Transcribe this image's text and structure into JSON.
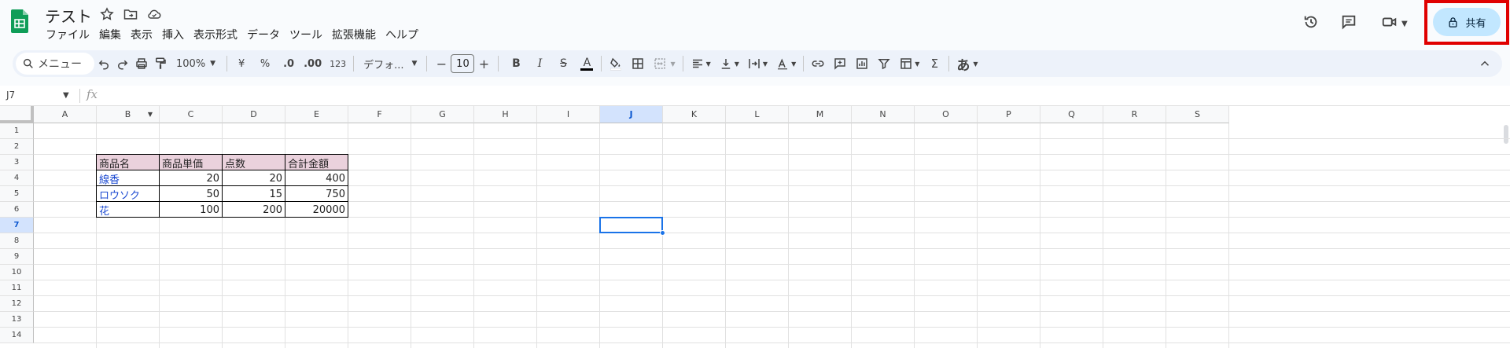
{
  "doc": {
    "title": "テスト"
  },
  "menu": [
    "ファイル",
    "編集",
    "表示",
    "挿入",
    "表示形式",
    "データ",
    "ツール",
    "拡張機能",
    "ヘルプ"
  ],
  "share": {
    "label": "共有"
  },
  "toolbar": {
    "search_label": "メニュー",
    "zoom": "100%",
    "currency": "¥",
    "percent": "%",
    "dec_decrease": ".0",
    "dec_increase": ".00",
    "number_format": "123",
    "font": "デフォ...",
    "font_size": "10",
    "minus": "−",
    "plus": "+",
    "bold": "B",
    "italic": "I",
    "strike": "S",
    "text_color": "A",
    "sigma": "Σ",
    "input_tool": "あ"
  },
  "formula_bar": {
    "cell_ref": "J7",
    "fx": "fx"
  },
  "columns": [
    "A",
    "B",
    "C",
    "D",
    "E",
    "F",
    "G",
    "H",
    "I",
    "J",
    "K",
    "L",
    "M",
    "N",
    "O",
    "P",
    "Q",
    "R",
    "S"
  ],
  "rows": [
    "1",
    "2",
    "3",
    "4",
    "5",
    "6",
    "7",
    "8",
    "9",
    "10",
    "11",
    "12",
    "13",
    "14"
  ],
  "selected": {
    "column": "J",
    "row": "7"
  },
  "table": {
    "headers": [
      "商品名",
      "商品単価",
      "点数",
      "合計金額"
    ],
    "rows": [
      [
        "線香",
        "20",
        "20",
        "400"
      ],
      [
        "ロウソク",
        "50",
        "15",
        "750"
      ],
      [
        "花",
        "100",
        "200",
        "20000"
      ]
    ]
  },
  "colors": {
    "header_fill": "#ead1dc",
    "share_bg": "#c2e7ff",
    "highlight": "#e00000",
    "selection": "#1a73e8"
  }
}
